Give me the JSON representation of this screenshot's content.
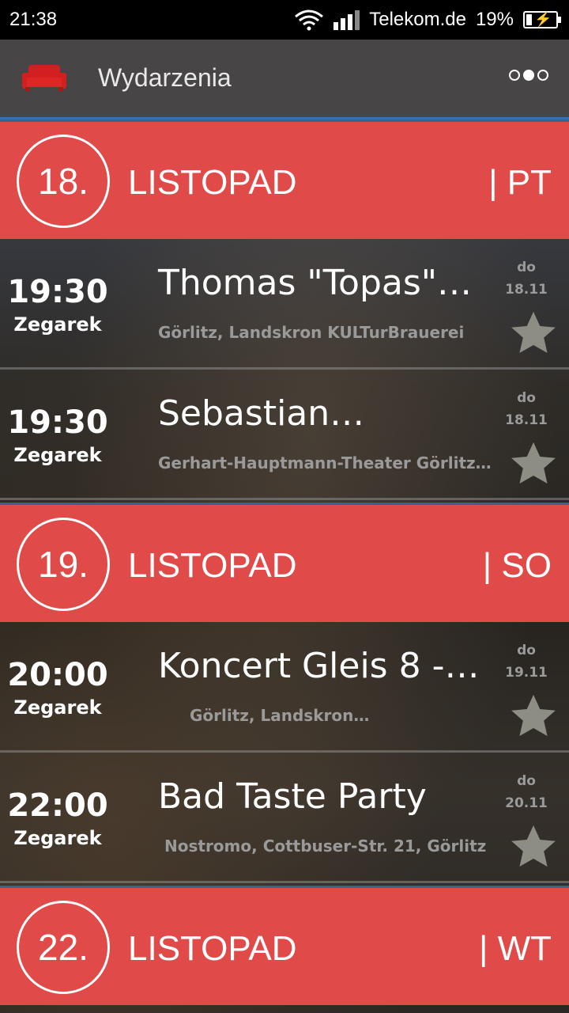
{
  "status_bar": {
    "time": "21:38",
    "carrier": "Telekom.de",
    "battery": "19%",
    "icons": [
      "wifi-icon",
      "signal-icon",
      "battery-charging-icon"
    ]
  },
  "app_bar": {
    "title": "Wydarzenia",
    "logo_icon": "sofa-icon",
    "menu_icon": "overflow-dots-icon",
    "accent_color": "#e04a48"
  },
  "days": [
    {
      "day": "18.",
      "month": "LISTOPAD",
      "weekday": "| PT",
      "events": [
        {
          "time": "19:30",
          "time_label": "Zegarek",
          "title": "Thomas \"Topas\"…",
          "location": "Görlitz, Landskron KULTurBrauerei",
          "until_label": "do",
          "until_date": "18.11"
        },
        {
          "time": "19:30",
          "time_label": "Zegarek",
          "title": "Sebastian…",
          "location": "Gerhart-Hauptmann-Theater Görlitz…",
          "until_label": "do",
          "until_date": "18.11"
        }
      ]
    },
    {
      "day": "19.",
      "month": "LISTOPAD",
      "weekday": "| SO",
      "events": [
        {
          "time": "20:00",
          "time_label": "Zegarek",
          "title": "Koncert Gleis 8 -…",
          "location": "Görlitz, Landskron…",
          "until_label": "do",
          "until_date": "19.11"
        },
        {
          "time": "22:00",
          "time_label": "Zegarek",
          "title": "Bad Taste Party",
          "location": "Nostromo, Cottbuser-Str. 21, Görlitz",
          "until_label": "do",
          "until_date": "20.11"
        }
      ]
    },
    {
      "day": "22.",
      "month": "LISTOPAD",
      "weekday": "| WT",
      "events": []
    }
  ]
}
